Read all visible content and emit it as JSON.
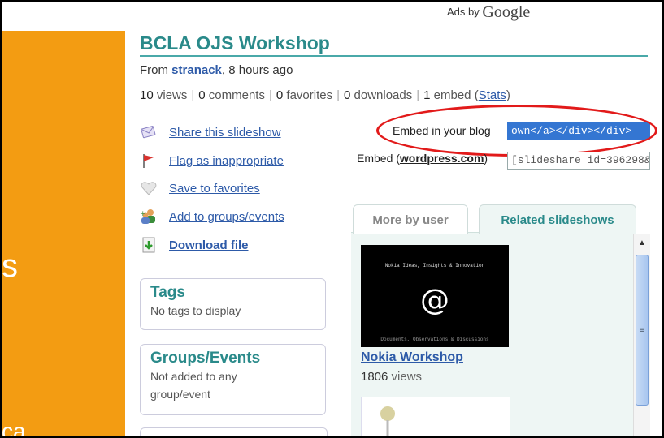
{
  "ads": {
    "prefix": "Ads by",
    "brand": "Google"
  },
  "left_panel": {
    "big_text": "s",
    "small_text": "ca"
  },
  "slideshow": {
    "title": "BCLA OJS Workshop",
    "from_prefix": "From ",
    "author": "stranack",
    "time": ", 8 hours ago"
  },
  "stats": {
    "views_n": "10",
    "views_l": " views",
    "comments_n": "0",
    "comments_l": " comments",
    "favorites_n": "0",
    "favorites_l": " favorites",
    "downloads_n": "0",
    "downloads_l": " downloads",
    "embed_n": "1",
    "embed_l": " embed ",
    "stats_link": "Stats"
  },
  "actions": {
    "share": "Share this slideshow",
    "flag": "Flag as inappropriate",
    "save": "Save to favorites",
    "add": "Add to groups/events",
    "download": "Download file"
  },
  "tags": {
    "title": "Tags",
    "text": "No tags to display"
  },
  "groups": {
    "title": "Groups/Events",
    "text": "Not added to any group/event"
  },
  "embed": {
    "blog_label": "Embed in your blog",
    "blog_value": "own</a></div></div>",
    "wp_label_prefix": "Embed (",
    "wp_link": "wordpress.com",
    "wp_label_suffix": ")",
    "wp_value": "[slideshare id=396298&"
  },
  "tabs": {
    "more": "More by user",
    "related": "Related slideshows"
  },
  "related": {
    "thumb_top": "Nokia Ideas, Insights & Innovation",
    "thumb_symbol": "@",
    "thumb_bottom": "Documents, Observations & Discussions",
    "title": "Nokia Workshop",
    "views_n": "1806",
    "views_l": " views"
  },
  "colors": {
    "accent": "#2a8a8a",
    "link": "#2d5aa8",
    "orange": "#F39C12",
    "highlight": "#e21a1a"
  }
}
